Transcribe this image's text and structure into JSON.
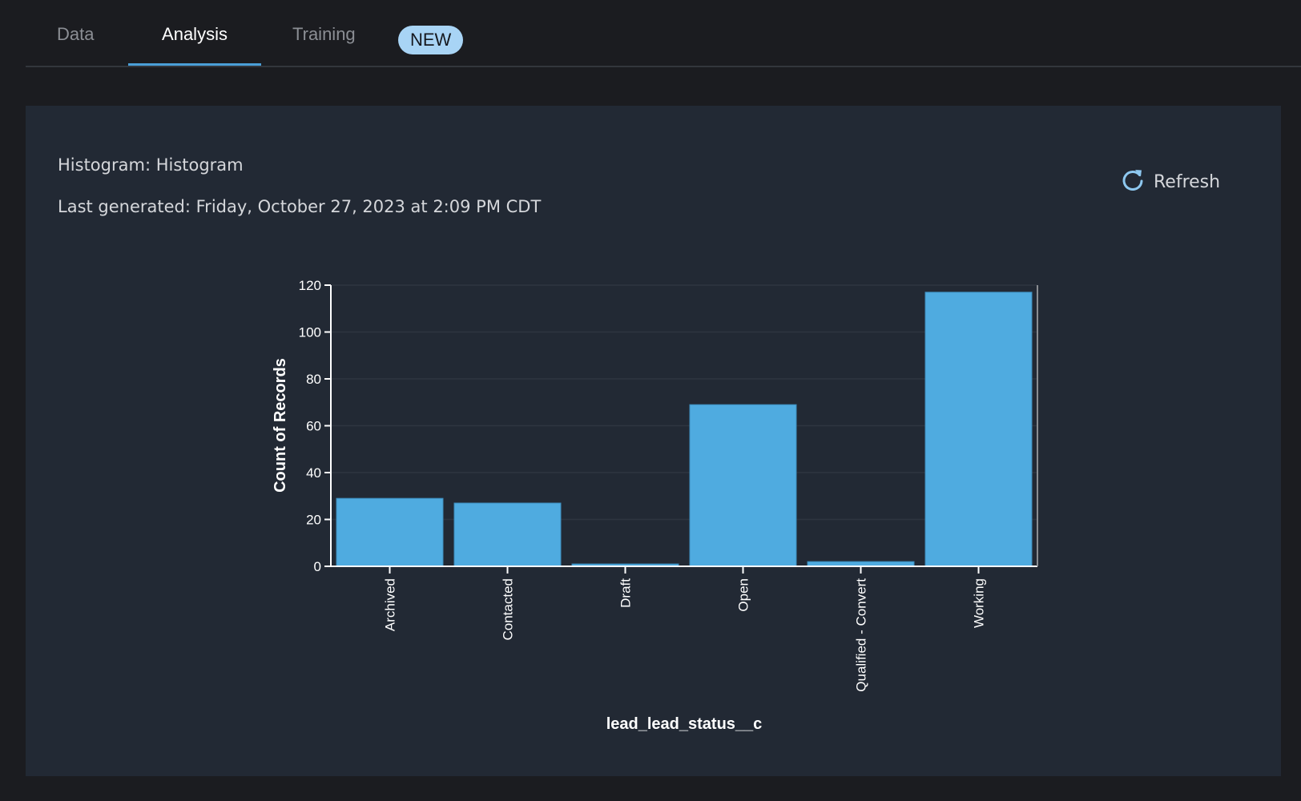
{
  "tabs": [
    {
      "label": "Data",
      "active": false
    },
    {
      "label": "Analysis",
      "active": true
    },
    {
      "label": "Training",
      "active": false,
      "badge": "NEW"
    }
  ],
  "panel": {
    "heading": "Histogram: Histogram",
    "last_generated": "Last generated: Friday, October 27, 2023 at 2:09 PM CDT",
    "refresh_label": "Refresh",
    "refresh_icon": "refresh-icon"
  },
  "colors": {
    "bar": "#4fabe0",
    "bar_stroke": "#3c8cbc",
    "accent": "#4a9fd8",
    "badge_bg": "#a8d4f5",
    "panel_bg": "#222934",
    "page_bg": "#1b1c20"
  },
  "chart_data": {
    "type": "bar",
    "title": "",
    "xlabel": "lead_lead_status__c",
    "ylabel": "Count of Records",
    "categories": [
      "Archived",
      "Contacted",
      "Draft",
      "Open",
      "Qualified - Convert",
      "Working"
    ],
    "values": [
      29,
      27,
      1,
      69,
      2,
      117
    ],
    "ylim": [
      0,
      120
    ],
    "yticks": [
      0,
      20,
      40,
      60,
      80,
      100,
      120
    ],
    "grid": true,
    "legend": "none"
  }
}
